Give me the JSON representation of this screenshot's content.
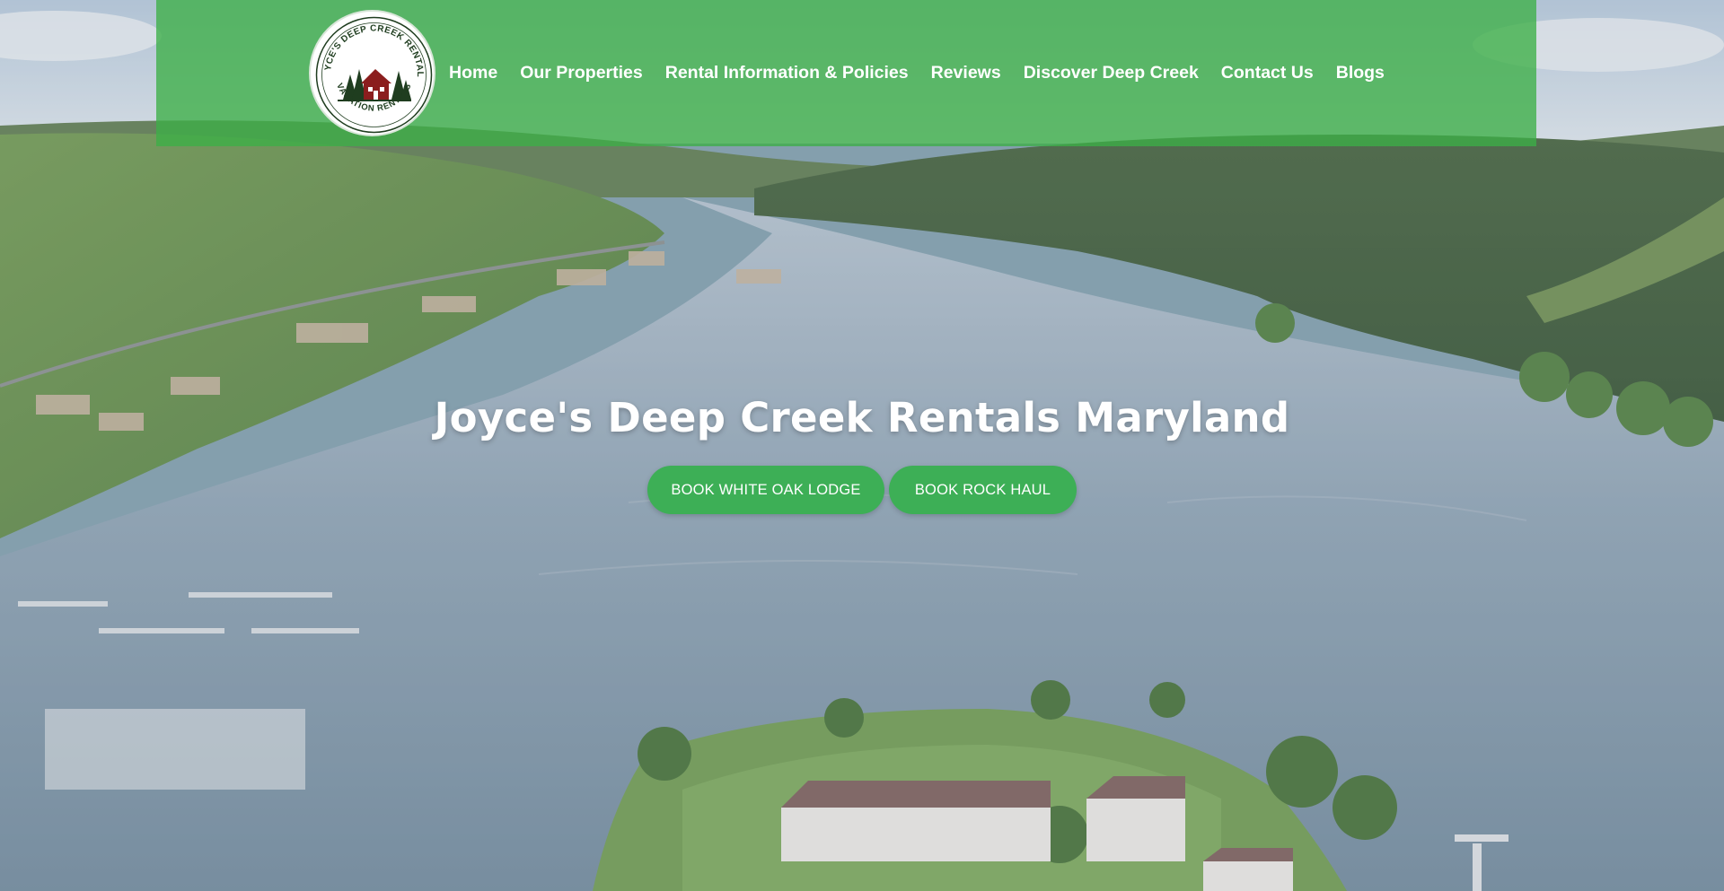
{
  "brand": {
    "logo_top_text": "JOYCE'S DEEP CREEK RENTALS",
    "logo_bottom_text": "VACATION RENTALS",
    "colors": {
      "header_green": "#3caf46",
      "button_green": "#3daf56",
      "cabin_red": "#8b1e1e",
      "tree_dark": "#1f3d1f"
    }
  },
  "nav": {
    "items": [
      {
        "label": "Home"
      },
      {
        "label": "Our Properties"
      },
      {
        "label": "Rental Information & Policies"
      },
      {
        "label": "Reviews"
      },
      {
        "label": "Discover Deep Creek"
      },
      {
        "label": "Contact Us"
      },
      {
        "label": "Blogs"
      }
    ]
  },
  "hero": {
    "title": "Joyce's Deep Creek Rentals Maryland",
    "buttons": [
      {
        "label": "BOOK WHITE OAK LODGE"
      },
      {
        "label": "BOOK ROCK HAUL"
      }
    ]
  }
}
